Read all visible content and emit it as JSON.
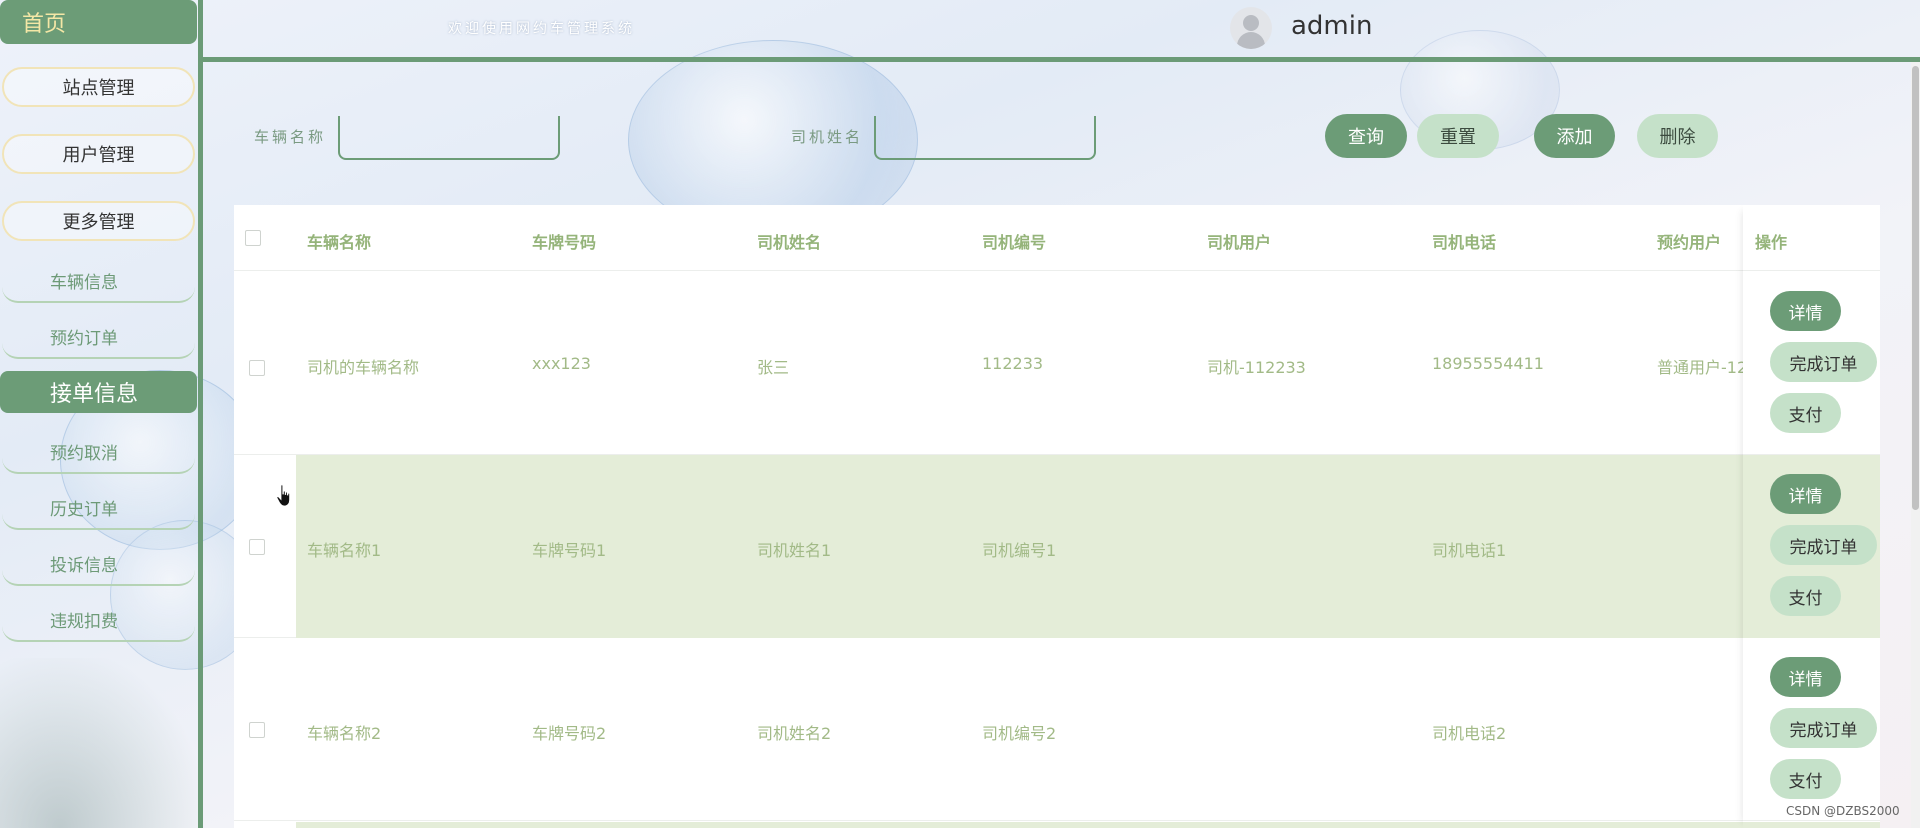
{
  "sidebar": {
    "home_label": "首页",
    "station_label": "站点管理",
    "user_label": "用户管理",
    "more_label": "更多管理",
    "sub_items_1": [
      "车辆信息",
      "预约订单"
    ],
    "orders_section_label": "接单信息",
    "sub_items_2": [
      "预约取消",
      "历史订单",
      "投诉信息",
      "违规扣费"
    ]
  },
  "header": {
    "welcome": "欢迎使用网约车管理系统",
    "username": "admin"
  },
  "search": {
    "vehicle_name_label": "车辆名称",
    "driver_name_label": "司机姓名",
    "vehicle_name_value": "",
    "driver_name_value": "",
    "query": "查询",
    "reset": "重置",
    "add": "添加",
    "delete": "删除"
  },
  "table": {
    "columns": [
      "车辆名称",
      "车牌号码",
      "司机姓名",
      "司机编号",
      "司机用户",
      "司机电话",
      "预约用户",
      "操作"
    ],
    "rows": [
      {
        "name": "司机的车辆名称",
        "plate": "xxx123",
        "driver": "张三",
        "driver_no": "112233",
        "driver_user": "司机-112233",
        "phone": "18955554411",
        "booking_user": "普通用户-12"
      },
      {
        "name": "车辆名称1",
        "plate": "车牌号码1",
        "driver": "司机姓名1",
        "driver_no": "司机编号1",
        "driver_user": "",
        "phone": "司机电话1",
        "booking_user": ""
      },
      {
        "name": "车辆名称2",
        "plate": "车牌号码2",
        "driver": "司机姓名2",
        "driver_no": "司机编号2",
        "driver_user": "",
        "phone": "司机电话2",
        "booking_user": ""
      }
    ],
    "row_actions": {
      "detail": "详情",
      "complete": "完成订单",
      "pay": "支付"
    }
  },
  "watermark": "CSDN @DZBS2000",
  "colors": {
    "primary": "#6c9c77",
    "primary_light": "#c5e1c9",
    "row_alt": "#e4edd8",
    "text_green": "#a2ba87"
  },
  "icons": {
    "avatar": "user-avatar-icon",
    "cursor": "hand-pointer-icon"
  }
}
